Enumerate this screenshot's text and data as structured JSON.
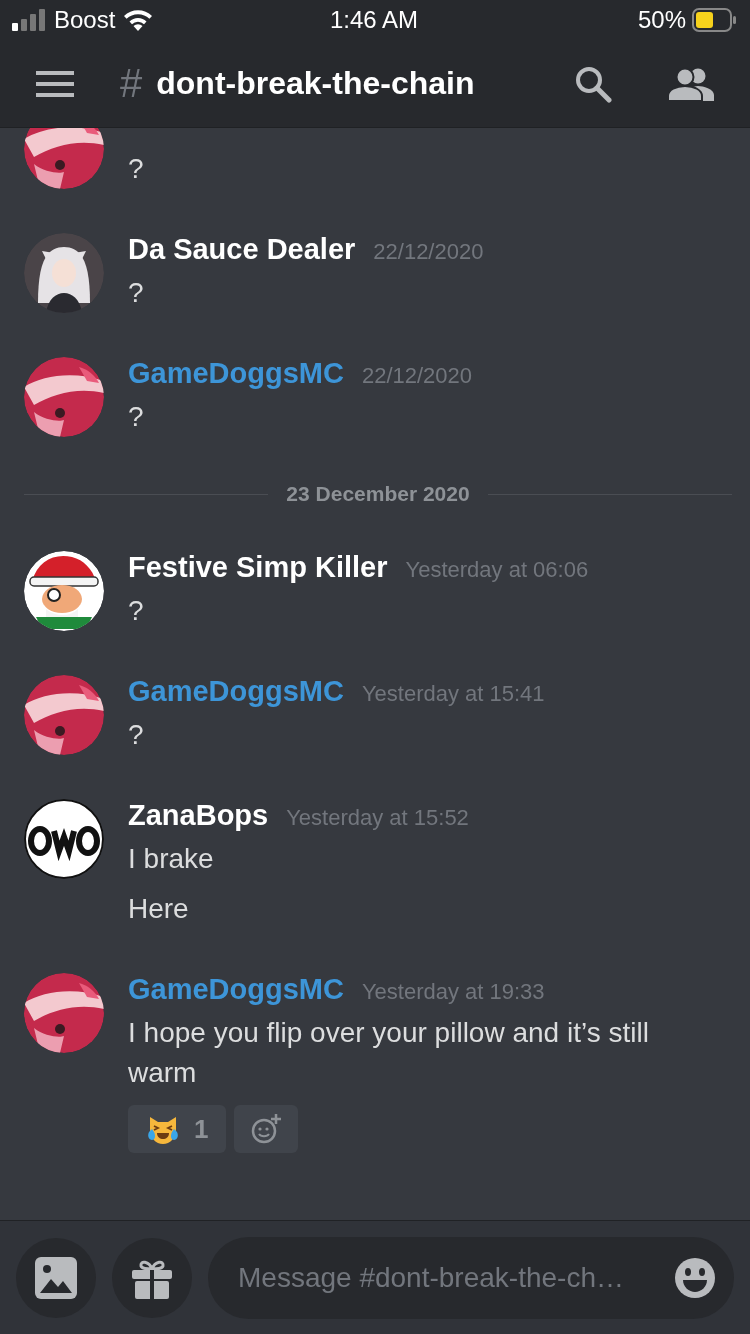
{
  "status_bar": {
    "carrier": "Boost",
    "time": "1:46 AM",
    "battery": "50%"
  },
  "header": {
    "hash": "#",
    "channel": "dont-break-the-chain"
  },
  "messages": [
    {
      "kind": "message",
      "avatar": {
        "kind": "pink"
      },
      "lines": [
        "?"
      ]
    },
    {
      "kind": "message",
      "avatar": {
        "kind": "anime"
      },
      "author": "Da Sauce Dealer",
      "color": "#ffffff",
      "timestamp": "22/12/2020",
      "lines": [
        "?"
      ]
    },
    {
      "kind": "message",
      "avatar": {
        "kind": "pink"
      },
      "author": "GameDoggsMC",
      "color": "#3d95d8",
      "timestamp": "22/12/2020",
      "lines": [
        "?"
      ]
    },
    {
      "kind": "date_divider",
      "label": "23 December 2020"
    },
    {
      "kind": "message",
      "avatar": {
        "kind": "santa"
      },
      "author": "Festive Simp Killer",
      "color": "#ffffff",
      "timestamp": "Yesterday at 06:06",
      "lines": [
        "?"
      ]
    },
    {
      "kind": "message",
      "avatar": {
        "kind": "pink"
      },
      "author": "GameDoggsMC",
      "color": "#3d95d8",
      "timestamp": "Yesterday at 15:41",
      "lines": [
        "?"
      ]
    },
    {
      "kind": "message",
      "avatar": {
        "kind": "owo"
      },
      "author": "ZanaBops",
      "color": "#ffffff",
      "timestamp": "Yesterday at 15:52",
      "lines": [
        "I brake",
        "Here"
      ]
    },
    {
      "kind": "message",
      "avatar": {
        "kind": "pink"
      },
      "author": "GameDoggsMC",
      "color": "#3d95d8",
      "timestamp": "Yesterday at 19:33",
      "lines": [
        "I hope you flip over your pillow and it’s still warm"
      ],
      "reactions": [
        {
          "count": "1",
          "selected": false
        }
      ]
    }
  ],
  "composer": {
    "placeholder": "Message #dont-break-the-ch…"
  }
}
